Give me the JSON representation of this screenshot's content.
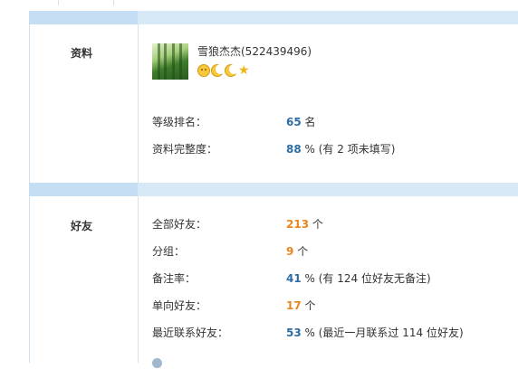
{
  "profile": {
    "section_label": "资料",
    "username": "雪狼杰杰(522439496)",
    "badges": [
      "sun-icon",
      "moon-icon",
      "moon-icon",
      "star-icon"
    ],
    "rank_label": "等级排名：",
    "rank_value": "65",
    "rank_unit": "名",
    "completeness_label": "资料完整度：",
    "completeness_value": "88",
    "completeness_suffix": "% (有 2 项未填写)"
  },
  "friends": {
    "section_label": "好友",
    "rows": [
      {
        "label": "全部好友：",
        "value": "213",
        "suffix": "个",
        "color": "orange"
      },
      {
        "label": "分组：",
        "value": "9",
        "suffix": "个",
        "color": "orange"
      },
      {
        "label": "备注率：",
        "value": "41",
        "suffix": "% (有 124 位好友无备注)",
        "color": "blue"
      },
      {
        "label": "单向好友：",
        "value": "17",
        "suffix": "个",
        "color": "orange"
      },
      {
        "label": "最近联系好友：",
        "value": "53",
        "suffix": "% (最近一月联系过 114 位好友)",
        "color": "blue"
      }
    ],
    "hint_text": "",
    "hint_link": ""
  },
  "colors": {
    "band": "#d7e9f7",
    "band_left": "#c5def3",
    "blue": "#2e6da4",
    "orange": "#e8861c"
  }
}
